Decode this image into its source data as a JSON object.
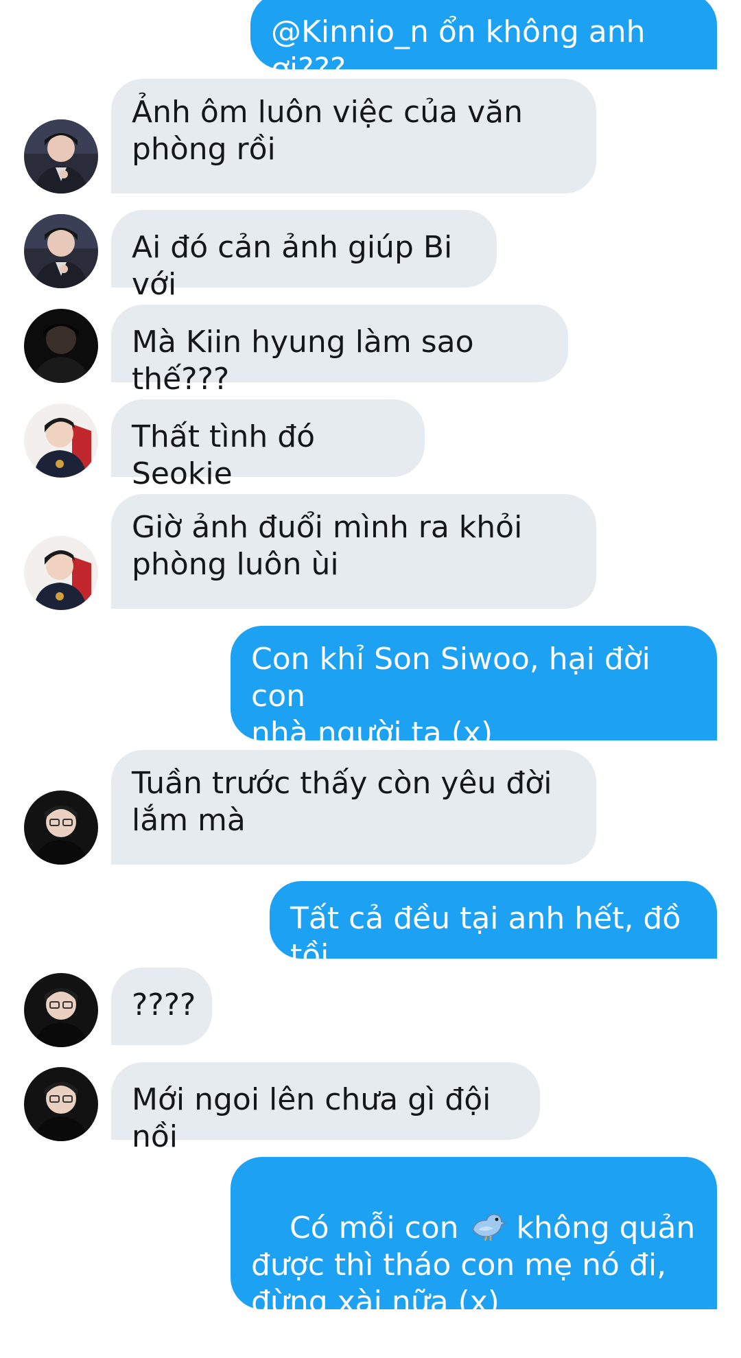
{
  "messages": [
    {
      "side": "out",
      "text": "@Kinnio_n ổn không anh ơi???"
    },
    {
      "side": "in",
      "avatar": "person-suit-avatar",
      "text": "Ảnh ôm luôn việc của văn\nphòng rồi"
    },
    {
      "side": "in",
      "avatar": "person-suit-avatar",
      "text": "Ai đó cản ảnh giúp Bi với"
    },
    {
      "side": "in",
      "avatar": "dark-person-avatar",
      "text": "Mà Kiin hyung làm sao thế???"
    },
    {
      "side": "in",
      "avatar": "person-chair-avatar",
      "text": "Thất tình đó Seokie"
    },
    {
      "side": "in",
      "avatar": "person-chair-avatar",
      "text": "Giờ ảnh đuổi mình ra khỏi\nphòng luôn ùi"
    },
    {
      "side": "out",
      "text": "Con khỉ Son Siwoo, hại đời con\nnhà người ta (x)"
    },
    {
      "side": "in",
      "avatar": "glasses-person-avatar",
      "text": "Tuần trước thấy còn yêu đời\nlắm mà"
    },
    {
      "side": "out",
      "text": "Tất cả đều tại anh hết, đồ tồi"
    },
    {
      "side": "in",
      "avatar": "glasses-person-avatar",
      "text": "????"
    },
    {
      "side": "in",
      "avatar": "glasses-person-avatar",
      "text": "Mới ngoi lên chưa gì đội nồi"
    },
    {
      "side": "out",
      "text_before": "Có mỗi con ",
      "emoji": "bird-emoji",
      "text_after": " không quản\nđược thì tháo con mẹ nó đi,\nđừng xài nữa (x)"
    }
  ]
}
